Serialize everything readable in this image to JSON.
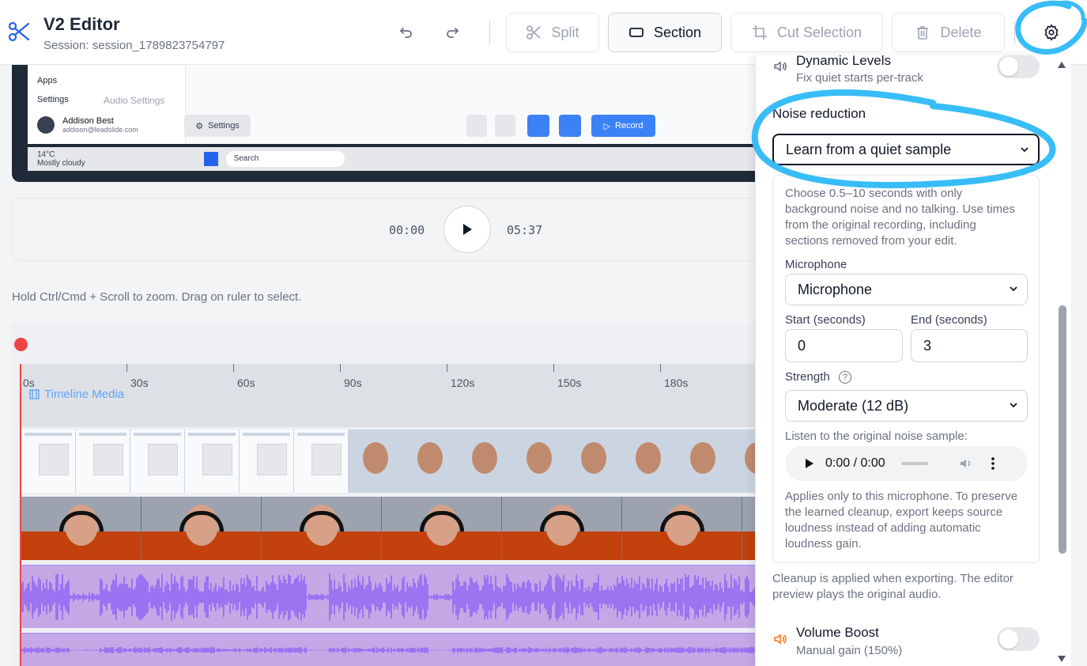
{
  "header": {
    "title": "V2 Editor",
    "session": "Session: session_1789823754797"
  },
  "toolbar": {
    "split": "Split",
    "section": "Section",
    "cut_selection": "Cut Selection",
    "delete": "Delete"
  },
  "preview": {
    "sidebar": {
      "apps": "Apps",
      "settings": "Settings",
      "user_name": "Addison Best",
      "user_email": "addison@leadslide.com",
      "audio_settings": "Audio Settings"
    },
    "settings_btn": "Settings",
    "record_btn": "Record",
    "taskbar": {
      "temp": "14°C",
      "weather": "Mostly cloudy",
      "search": "Search"
    }
  },
  "player": {
    "current": "00:00",
    "total": "05:37"
  },
  "hint": "Hold Ctrl/Cmd + Scroll to zoom. Drag on ruler to select.",
  "timeline": {
    "ticks": [
      "0s",
      "30s",
      "60s",
      "90s",
      "120s",
      "150s",
      "180s"
    ],
    "media_label": "Timeline Media"
  },
  "panel": {
    "dynamic_levels": {
      "title": "Dynamic Levels",
      "subtitle": "Fix quiet starts per-track",
      "enabled": false
    },
    "noise_reduction": {
      "label": "Noise reduction",
      "mode": "Learn from a quiet sample",
      "description": "Choose 0.5–10 seconds with only background noise and no talking. Use times from the original recording, including sections removed from your edit.",
      "microphone_label": "Microphone",
      "microphone_value": "Microphone",
      "start_label": "Start (seconds)",
      "start_value": "0",
      "end_label": "End (seconds)",
      "end_value": "3",
      "strength_label": "Strength",
      "strength_value": "Moderate (12 dB)",
      "listen_label": "Listen to the original noise sample:",
      "audio_time": "0:00 / 0:00",
      "note": "Applies only to this microphone. To preserve the learned cleanup, export keeps source loudness instead of adding automatic loudness gain."
    },
    "cleanup_note": "Cleanup is applied when exporting. The editor preview plays the original audio.",
    "volume_boost": {
      "title": "Volume Boost",
      "subtitle": "Manual gain (150%)",
      "enabled": false
    }
  },
  "colors": {
    "accent": "#2563eb",
    "annotation": "#38bdf8",
    "audio_track": "#c4a8e6",
    "playhead": "#ef4444",
    "timeline_label": "#60a5fa"
  }
}
